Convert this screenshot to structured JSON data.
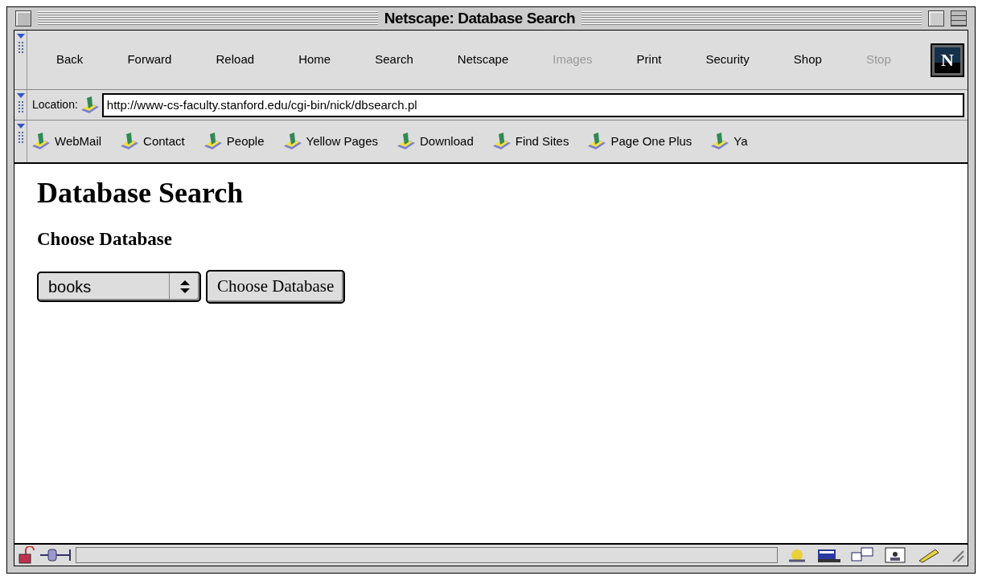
{
  "window": {
    "title": "Netscape: Database Search"
  },
  "toolbar": [
    {
      "label": "Back",
      "disabled": false
    },
    {
      "label": "Forward",
      "disabled": false
    },
    {
      "label": "Reload",
      "disabled": false
    },
    {
      "label": "Home",
      "disabled": false
    },
    {
      "label": "Search",
      "disabled": false
    },
    {
      "label": "Netscape",
      "disabled": false
    },
    {
      "label": "Images",
      "disabled": true
    },
    {
      "label": "Print",
      "disabled": false
    },
    {
      "label": "Security",
      "disabled": false
    },
    {
      "label": "Shop",
      "disabled": false
    },
    {
      "label": "Stop",
      "disabled": true
    }
  ],
  "logo": {
    "letter": "N"
  },
  "location": {
    "label": "Location:",
    "value": "http://www-cs-faculty.stanford.edu/cgi-bin/nick/dbsearch.pl"
  },
  "personal_toolbar": [
    "WebMail",
    "Contact",
    "People",
    "Yellow Pages",
    "Download",
    "Find Sites",
    "Page One Plus",
    "Ya"
  ],
  "page": {
    "heading": "Database Search",
    "subheading": "Choose Database",
    "select": {
      "value": "books"
    },
    "button": "Choose Database"
  }
}
